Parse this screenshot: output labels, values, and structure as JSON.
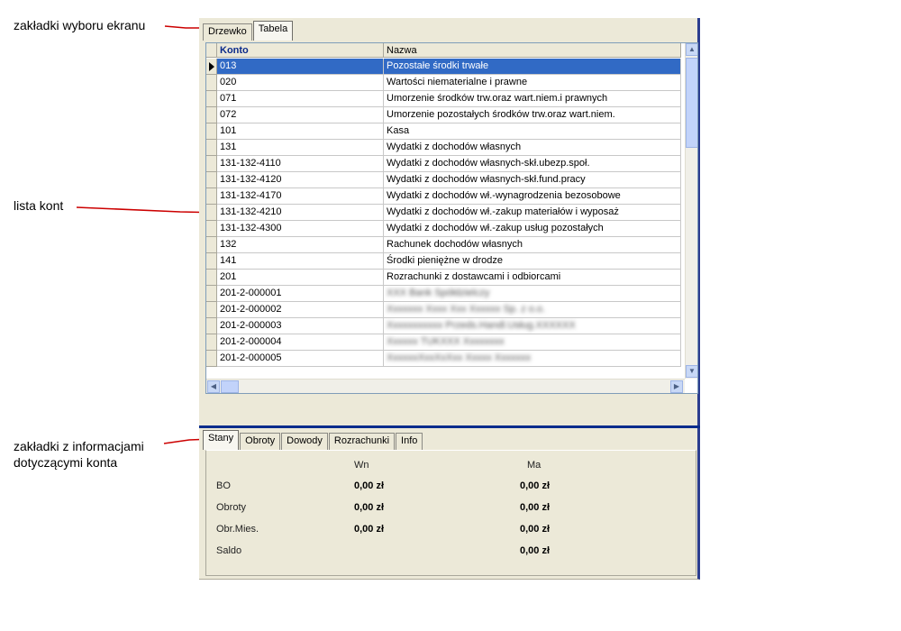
{
  "annotations": {
    "screen_tabs": "zakładki wyboru ekranu",
    "account_list": "lista kont",
    "info_tabs_line1": "zakładki z informacjami",
    "info_tabs_line2": "dotyczącymi konta"
  },
  "screen_tabs": [
    "Drzewko",
    "Tabela"
  ],
  "table": {
    "headers": [
      "Konto",
      "Nazwa"
    ],
    "rows": [
      {
        "konto": "013",
        "nazwa": "Pozostałe środki trwałe",
        "selected": true
      },
      {
        "konto": "020",
        "nazwa": "Wartości niematerialne i prawne"
      },
      {
        "konto": "071",
        "nazwa": "Umorzenie środków trw.oraz wart.niem.i prawnych"
      },
      {
        "konto": "072",
        "nazwa": "Umorzenie pozostałych środków trw.oraz wart.niem."
      },
      {
        "konto": "101",
        "nazwa": "Kasa"
      },
      {
        "konto": "131",
        "nazwa": "Wydatki z dochodów własnych"
      },
      {
        "konto": "131-132-4110",
        "nazwa": "Wydatki z dochodów własnych-skł.ubezp.społ."
      },
      {
        "konto": "131-132-4120",
        "nazwa": "Wydatki z dochodów własnych-skł.fund.pracy"
      },
      {
        "konto": "131-132-4170",
        "nazwa": "Wydatki z dochodów wł.-wynagrodzenia bezosobowe"
      },
      {
        "konto": "131-132-4210",
        "nazwa": "Wydatki z dochodów wł.-zakup materiałów i wyposaż"
      },
      {
        "konto": "131-132-4300",
        "nazwa": "Wydatki z dochodów wł.-zakup usług pozostałych"
      },
      {
        "konto": "132",
        "nazwa": "Rachunek dochodów własnych"
      },
      {
        "konto": "141",
        "nazwa": "Środki pieniężne w drodze"
      },
      {
        "konto": "201",
        "nazwa": "Rozrachunki z dostawcami i odbiorcami"
      },
      {
        "konto": "201-2-000001",
        "nazwa": "XXX Bank Spółdzielczy",
        "blurred": true
      },
      {
        "konto": "201-2-000002",
        "nazwa": "Xxxxxxx Xxxx Xxx Xxxxxx Sp. z o.o.",
        "blurred": true
      },
      {
        "konto": "201-2-000003",
        "nazwa": "Xxxxxxxxxxx Przeds.Handl.Usług.XXXXXX",
        "blurred": true
      },
      {
        "konto": "201-2-000004",
        "nazwa": "Xxxxxx TUKXXX Xxxxxxxx",
        "blurred": true
      },
      {
        "konto": "201-2-000005",
        "nazwa": "XxxxxxXxxXxXxx Xxxxx Xxxxxxx",
        "blurred": true
      }
    ]
  },
  "info_tabs": [
    "Stany",
    "Obroty",
    "Dowody",
    "Rozrachunki",
    "Info"
  ],
  "stany": {
    "col_wn": "Wn",
    "col_ma": "Ma",
    "rows": [
      {
        "label": "BO",
        "wn": "0,00 zł",
        "ma": "0,00 zł"
      },
      {
        "label": "Obroty",
        "wn": "0,00 zł",
        "ma": "0,00 zł"
      },
      {
        "label": "Obr.Mies.",
        "wn": "0,00 zł",
        "ma": "0,00 zł"
      },
      {
        "label": "Saldo",
        "wn": "",
        "ma": "0,00 zł"
      }
    ]
  },
  "colors": {
    "selection": "#316ac5",
    "accent": "#0a2c8c",
    "annotation_line": "#cc0000"
  }
}
